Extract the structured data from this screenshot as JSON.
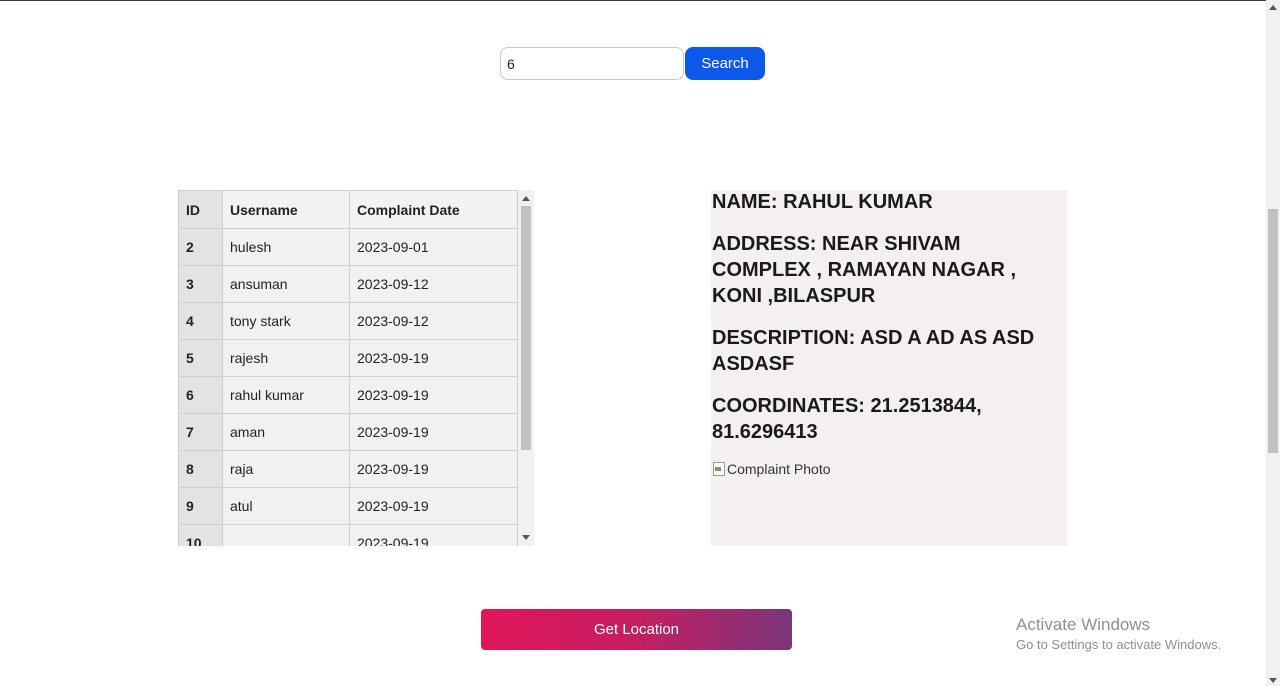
{
  "search": {
    "value": "6",
    "button_label": "Search"
  },
  "table": {
    "headers": [
      "ID",
      "Username",
      "Complaint Date"
    ],
    "rows": [
      {
        "id": "2",
        "username": "hulesh",
        "date": "2023-09-01"
      },
      {
        "id": "3",
        "username": "ansuman",
        "date": "2023-09-12"
      },
      {
        "id": "4",
        "username": "tony stark",
        "date": "2023-09-12"
      },
      {
        "id": "5",
        "username": "rajesh",
        "date": "2023-09-19"
      },
      {
        "id": "6",
        "username": "rahul kumar",
        "date": "2023-09-19"
      },
      {
        "id": "7",
        "username": "aman",
        "date": "2023-09-19"
      },
      {
        "id": "8",
        "username": "raja",
        "date": "2023-09-19"
      },
      {
        "id": "9",
        "username": "atul",
        "date": "2023-09-19"
      },
      {
        "id": "10",
        "username": "",
        "date": "2023-09-19"
      }
    ]
  },
  "details": {
    "name": "NAME: RAHUL KUMAR",
    "address": "ADDRESS: NEAR SHIVAM COMPLEX , RAMAYAN NAGAR , KONI ,BILASPUR",
    "description": "DESCRIPTION: ASD A AD AS ASD ASDASF",
    "coordinates": "COORDINATES: 21.2513844, 81.6296413",
    "photo_alt": "Complaint Photo",
    "photo_icon": "broken-image-icon"
  },
  "get_location_label": "Get Location",
  "watermark": {
    "title": "Activate Windows",
    "subtitle": "Go to Settings to activate Windows."
  },
  "colors": {
    "search_button": "#0d57ea",
    "gradient_start": "#e0165a",
    "gradient_end": "#7b357a"
  }
}
